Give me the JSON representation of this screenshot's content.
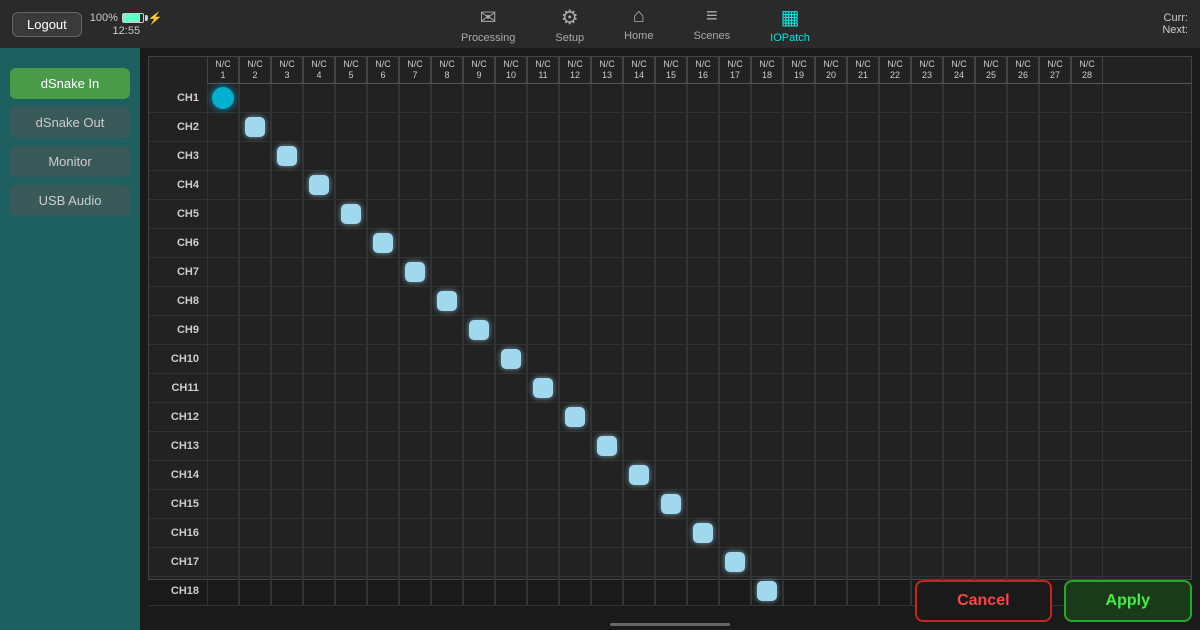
{
  "topbar": {
    "logout_label": "Logout",
    "battery_percent": "100%",
    "time": "12:55",
    "curr_label": "Curr:",
    "next_label": "Next:",
    "nav_items": [
      {
        "id": "processing",
        "label": "Processing",
        "icon": "✉",
        "active": false
      },
      {
        "id": "setup",
        "label": "Setup",
        "icon": "⚙",
        "active": false
      },
      {
        "id": "home",
        "label": "Home",
        "icon": "⌂",
        "active": false
      },
      {
        "id": "scenes",
        "label": "Scenes",
        "icon": "≡",
        "active": false
      },
      {
        "id": "iopatch",
        "label": "IOPatch",
        "icon": "▦",
        "active": true
      }
    ]
  },
  "sidebar": {
    "items": [
      {
        "id": "dsnake-in",
        "label": "dSnake In",
        "active": true
      },
      {
        "id": "dsnake-out",
        "label": "dSnake Out",
        "active": false
      },
      {
        "id": "monitor",
        "label": "Monitor",
        "active": false
      },
      {
        "id": "usb-audio",
        "label": "USB Audio",
        "active": false
      }
    ]
  },
  "grid": {
    "col_headers": [
      {
        "label": "N/C\n1"
      },
      {
        "label": "N/C\n2"
      },
      {
        "label": "N/C\n3"
      },
      {
        "label": "N/C\n4"
      },
      {
        "label": "N/C\n5"
      },
      {
        "label": "N/C\n6"
      },
      {
        "label": "N/C\n7"
      },
      {
        "label": "N/C\n8"
      },
      {
        "label": "N/C\n9"
      },
      {
        "label": "N/C\n10"
      },
      {
        "label": "N/C\n11"
      },
      {
        "label": "N/C\n12"
      },
      {
        "label": "N/C\n13"
      },
      {
        "label": "N/C\n14"
      },
      {
        "label": "N/C\n15"
      },
      {
        "label": "N/C\n16"
      },
      {
        "label": "N/C\n17"
      },
      {
        "label": "N/C\n18"
      },
      {
        "label": "N/C\n19"
      },
      {
        "label": "N/C\n20"
      },
      {
        "label": "N/C\n21"
      },
      {
        "label": "N/C\n22"
      },
      {
        "label": "N/C\n23"
      },
      {
        "label": "N/C\n24"
      },
      {
        "label": "N/C\n25"
      },
      {
        "label": "N/C\n26"
      },
      {
        "label": "N/C\n27"
      },
      {
        "label": "N/C\n28"
      }
    ],
    "rows": [
      {
        "label": "CH1",
        "active_col": 0,
        "circle": true
      },
      {
        "label": "CH2",
        "active_col": 1,
        "circle": false
      },
      {
        "label": "CH3",
        "active_col": 2,
        "circle": false
      },
      {
        "label": "CH4",
        "active_col": 3,
        "circle": false
      },
      {
        "label": "CH5",
        "active_col": 4,
        "circle": false
      },
      {
        "label": "CH6",
        "active_col": 5,
        "circle": false
      },
      {
        "label": "CH7",
        "active_col": 6,
        "circle": false
      },
      {
        "label": "CH8",
        "active_col": 7,
        "circle": false
      },
      {
        "label": "CH9",
        "active_col": 8,
        "circle": false
      },
      {
        "label": "CH10",
        "active_col": 9,
        "circle": false
      },
      {
        "label": "CH11",
        "active_col": 10,
        "circle": false
      },
      {
        "label": "CH12",
        "active_col": 11,
        "circle": false
      },
      {
        "label": "CH13",
        "active_col": 12,
        "circle": false
      },
      {
        "label": "CH14",
        "active_col": 13,
        "circle": false
      },
      {
        "label": "CH15",
        "active_col": 14,
        "circle": false
      },
      {
        "label": "CH16",
        "active_col": 15,
        "circle": false
      },
      {
        "label": "CH17",
        "active_col": 16,
        "circle": false
      },
      {
        "label": "CH18",
        "active_col": 17,
        "circle": false
      }
    ],
    "num_cols": 28
  },
  "buttons": {
    "cancel_label": "Cancel",
    "apply_label": "Apply"
  }
}
